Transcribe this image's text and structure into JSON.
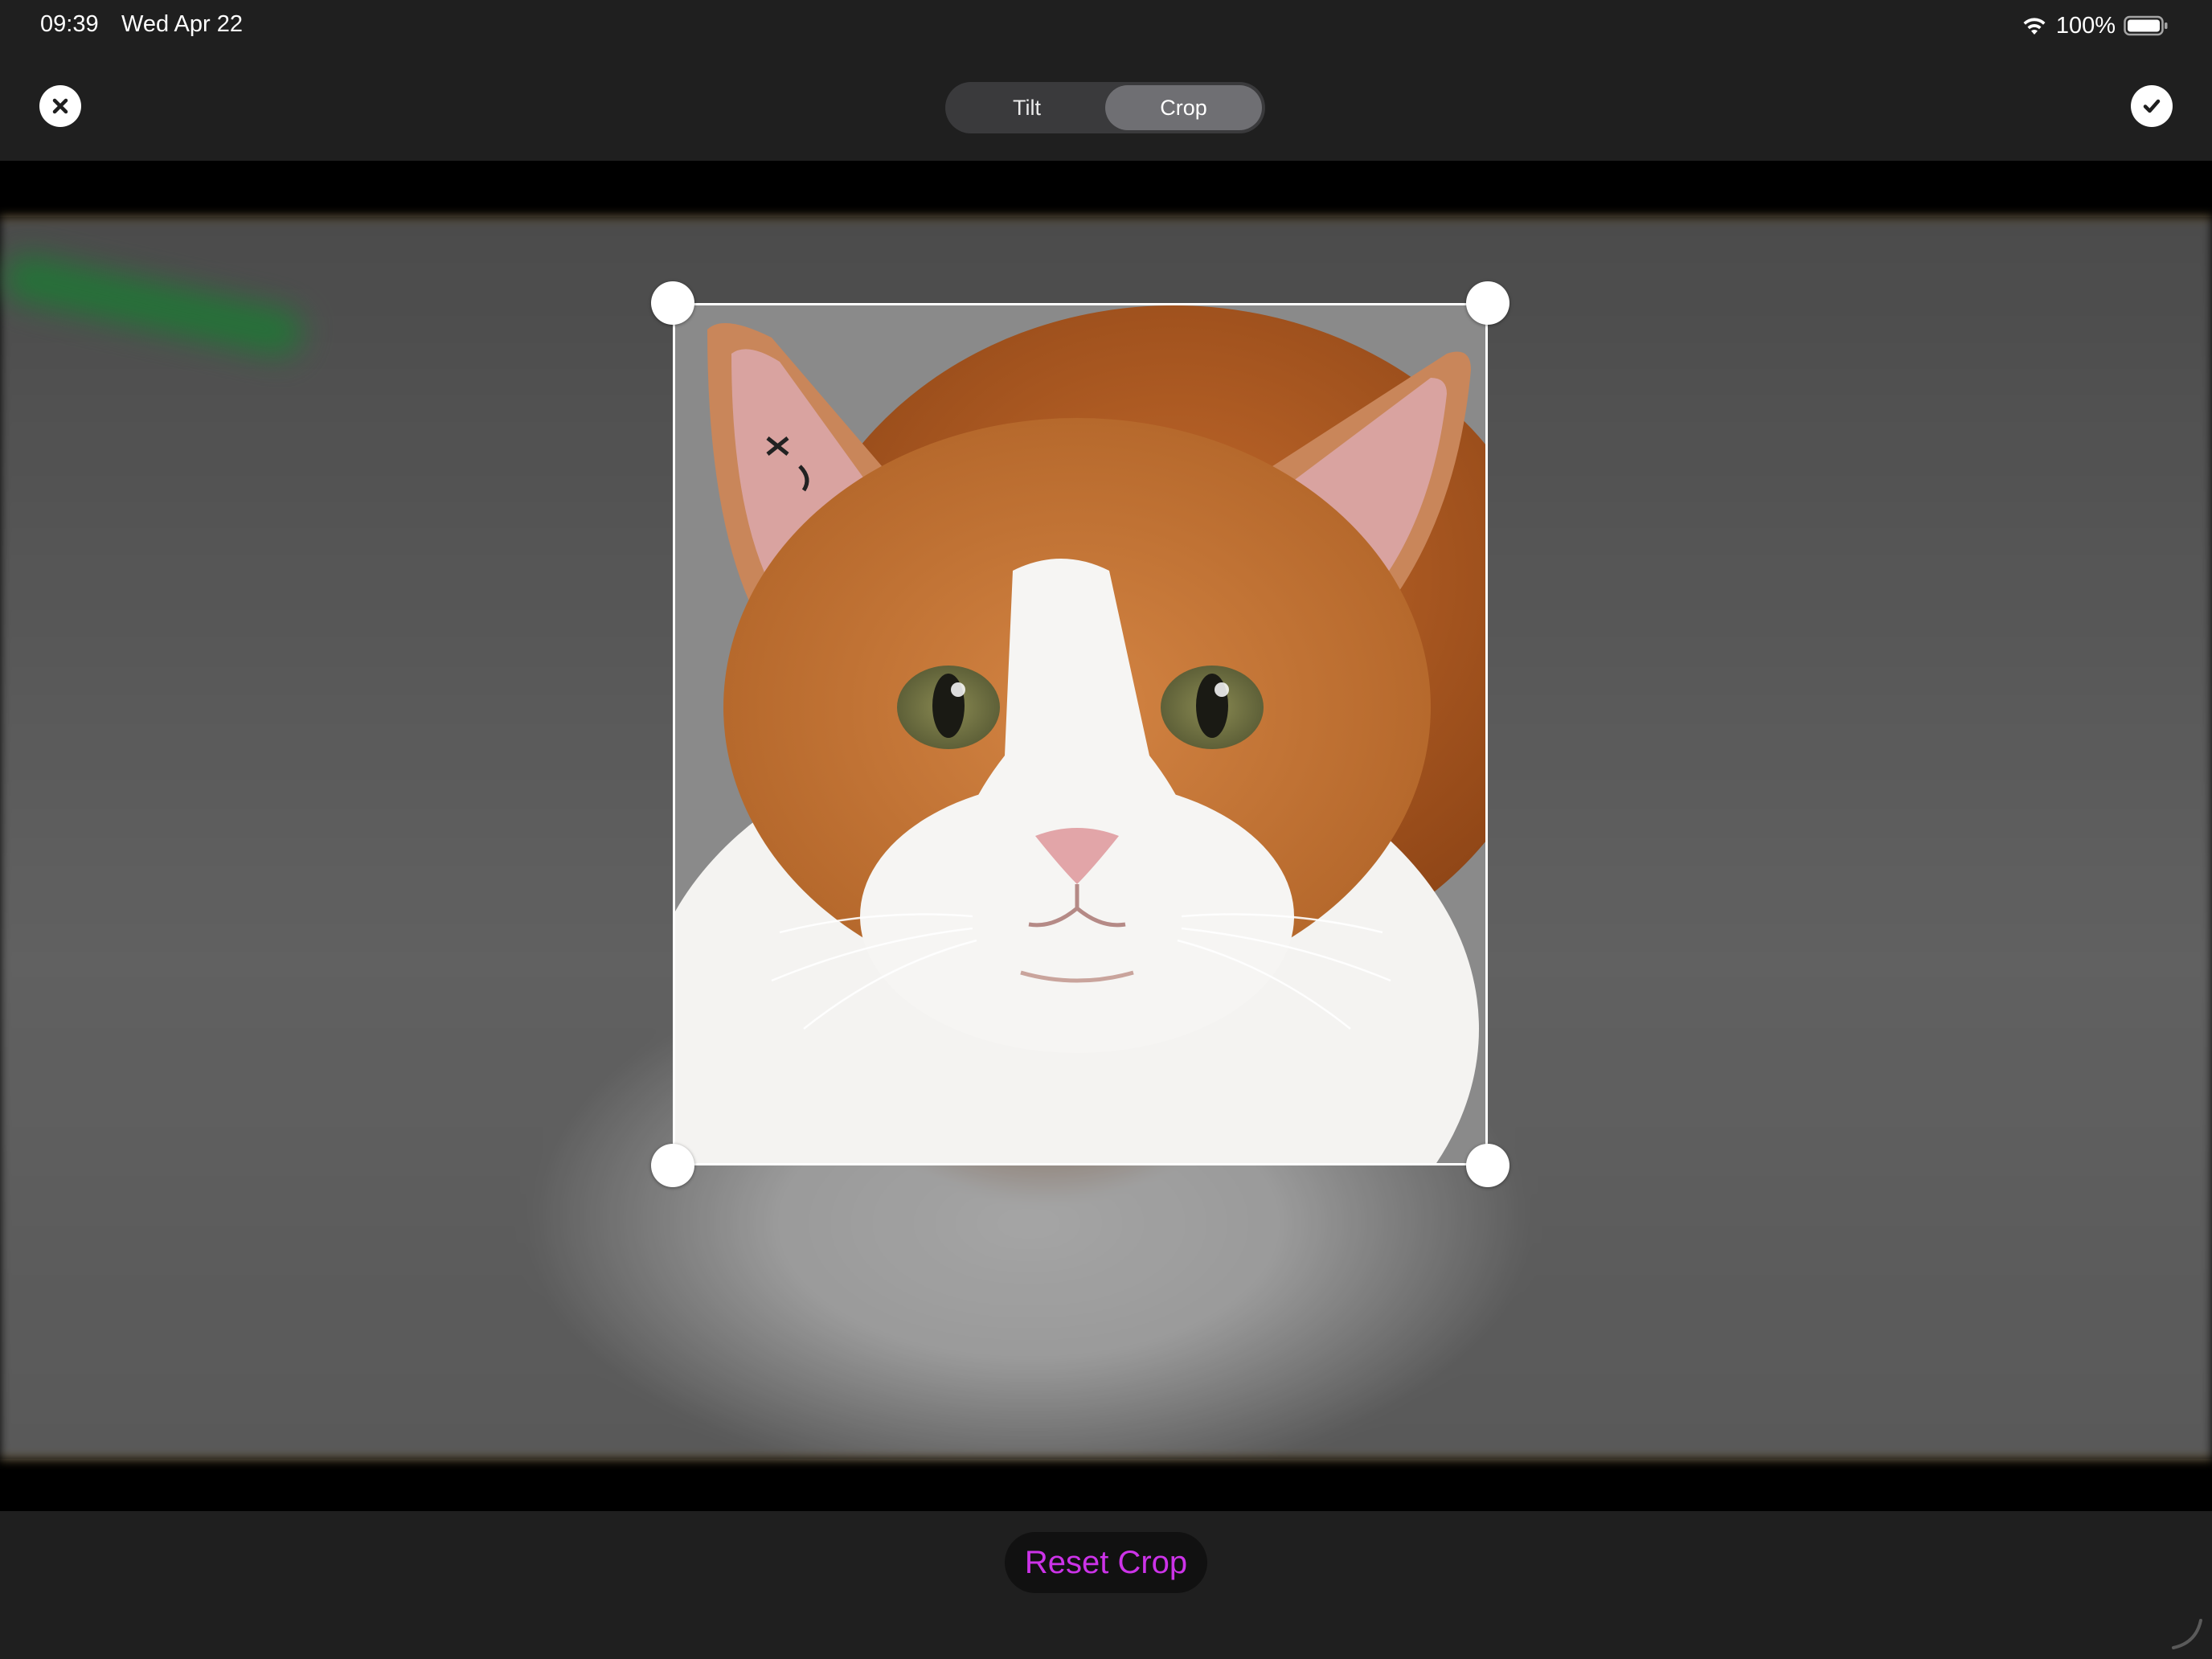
{
  "status_bar": {
    "time": "09:39",
    "date": "Wed Apr 22",
    "battery": "100%"
  },
  "toolbar": {
    "segments": [
      {
        "label": "Tilt",
        "selected": false
      },
      {
        "label": "Crop",
        "selected": true
      }
    ],
    "cancel_icon": "close-icon",
    "done_icon": "checkmark-icon"
  },
  "bottom": {
    "reset_label": "Reset Crop"
  },
  "colors": {
    "accent": "#cc33e8",
    "frame_outline": "#b8862c",
    "background": "#1f1f1f"
  }
}
